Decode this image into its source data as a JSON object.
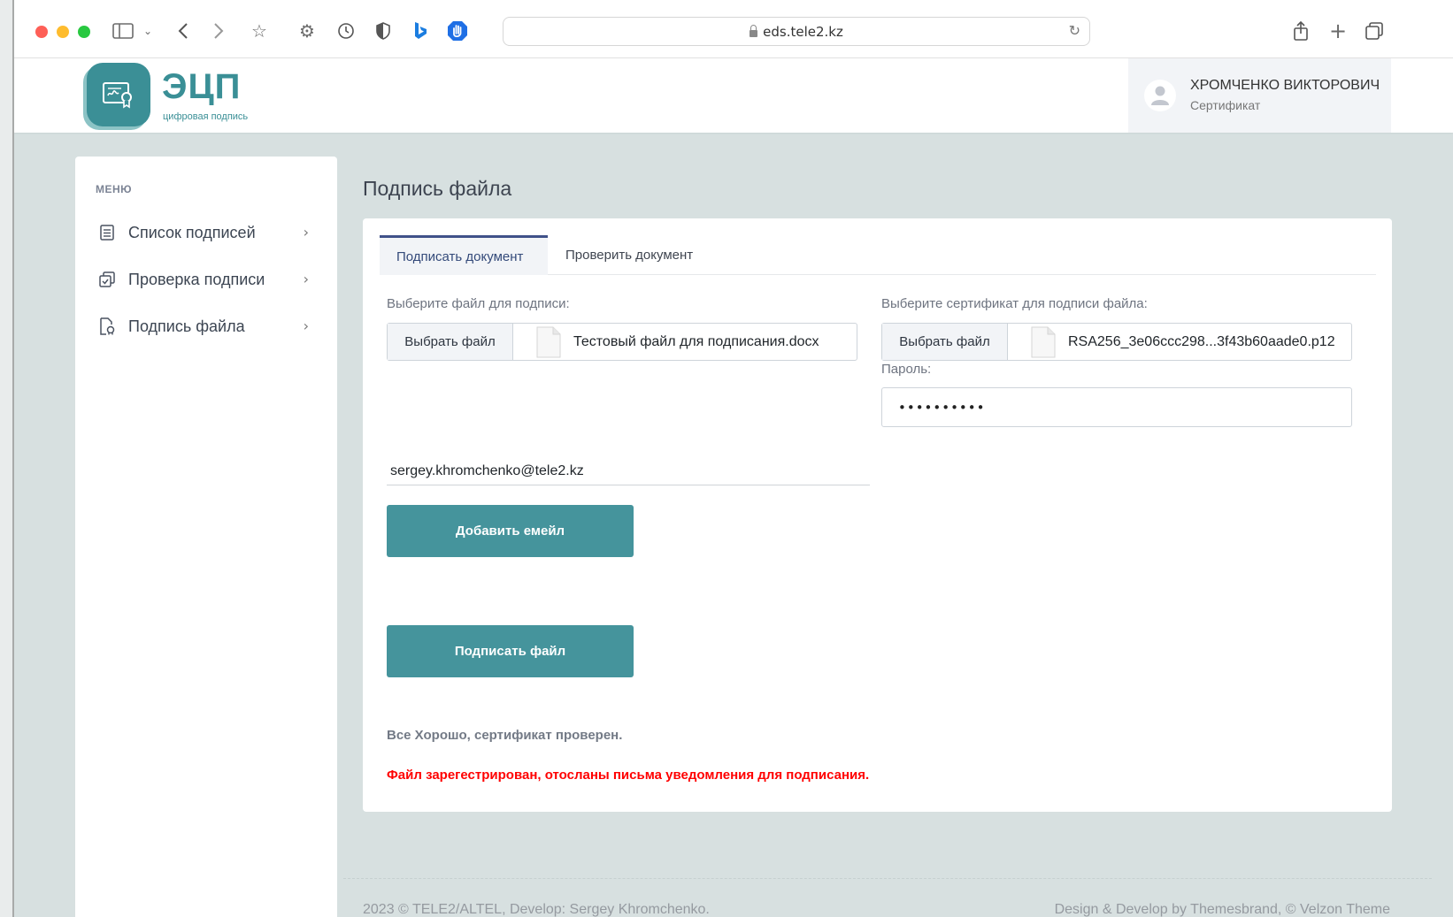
{
  "browser": {
    "url": "eds.tele2.kz"
  },
  "header": {
    "logo_title": "ЭЦП",
    "logo_subtitle": "цифровая подпись",
    "user_name": "ХРОМЧЕНКО ВИКТОРОВИЧ",
    "user_role": "Сертификат"
  },
  "sidebar": {
    "menu_title": "МЕНЮ",
    "items": [
      {
        "label": "Список подписей",
        "icon": "list-icon"
      },
      {
        "label": "Проверка подписи",
        "icon": "copy-check-icon"
      },
      {
        "label": "Подпись файла",
        "icon": "file-signature-icon"
      }
    ]
  },
  "main": {
    "page_title": "Подпись файла",
    "tabs": [
      {
        "label": "Подписать документ",
        "active": true
      },
      {
        "label": "Проверить документ",
        "active": false
      }
    ],
    "file_label": "Выберите файл для подписи:",
    "file_button": "Выбрать файл",
    "file_name": "Тестовый файл для подписания.docx",
    "cert_label": "Выберите сертификат для подписи файла:",
    "cert_button": "Выбрать файл",
    "cert_name": "RSA256_3e06ccc298...3f43b60aade0.p12",
    "password_label": "Пароль:",
    "password_value": "••••••••••",
    "email_value": "sergey.khromchenko@tele2.kz",
    "add_email_button": "Добавить емейл",
    "sign_button": "Подписать файл",
    "success_message": "Все Хорошо, сертификат проверен.",
    "status_message": "Файл зарегестрирован, отосланы письма уведомления для подписания."
  },
  "footer": {
    "left": "2023 © TELE2/ALTEL, Develop: Sergey Khromchenko.",
    "right": "Design & Develop by Themesbrand, © Velzon Theme"
  },
  "colors": {
    "accent": "#45949c",
    "tab_active_border": "#405189",
    "error": "#ff0000"
  }
}
